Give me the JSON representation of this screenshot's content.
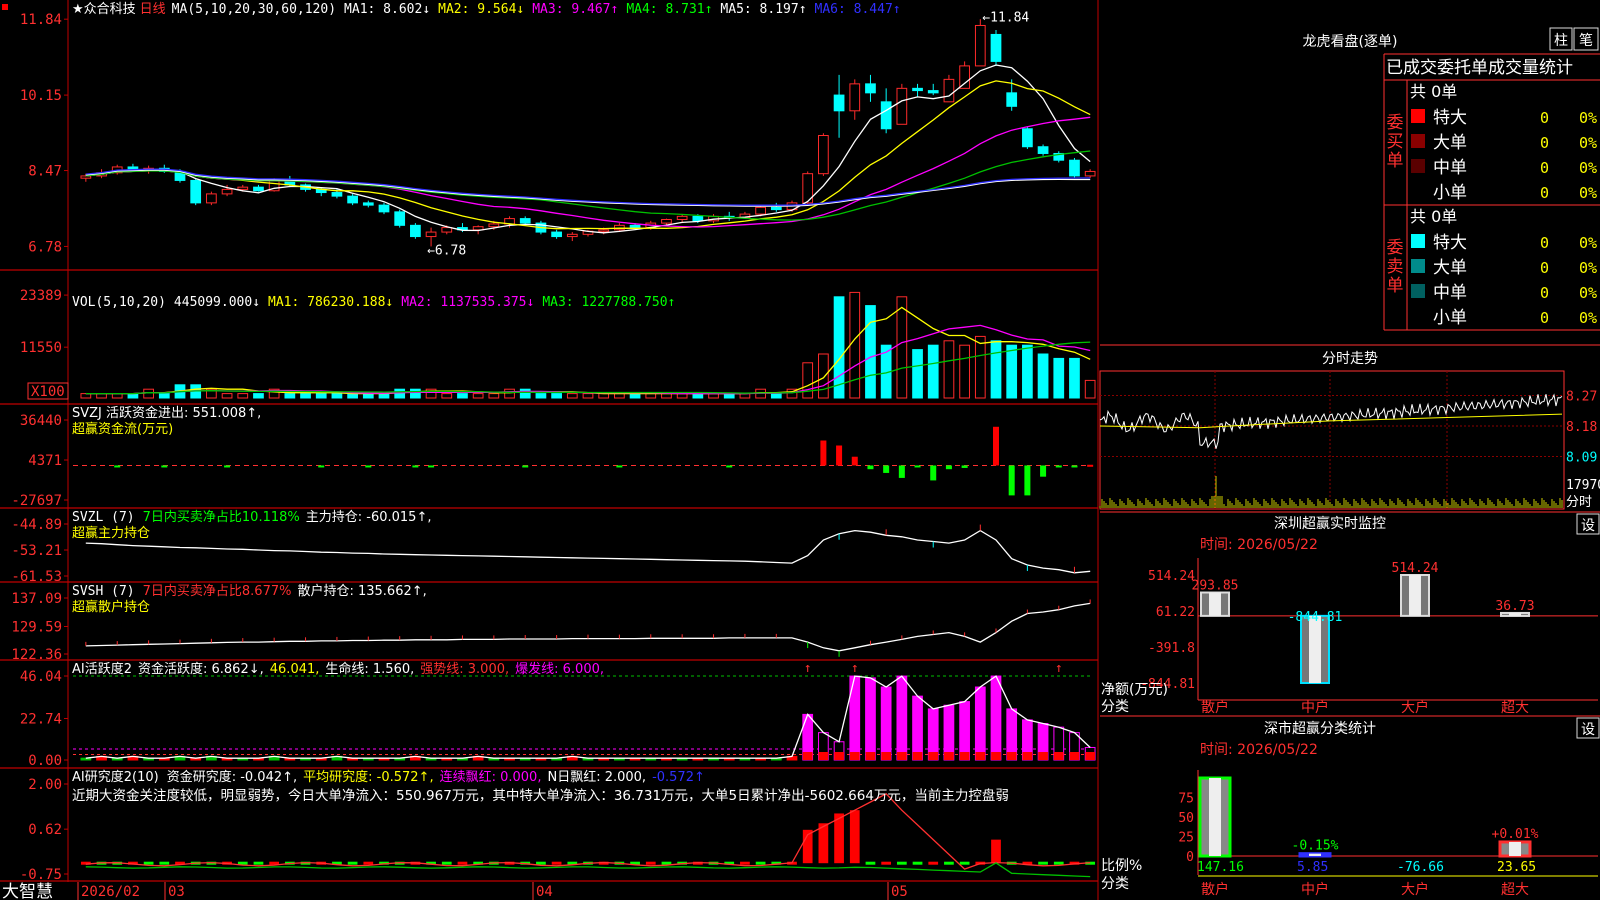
{
  "colors": {
    "up": "#ff2b2b",
    "down": "#00ffff",
    "grid": "#c00000",
    "yellow": "#ffff00",
    "magenta": "#ff00ff",
    "green": "#00c000",
    "white": "#ffffff"
  },
  "stock": {
    "name": "★众合科技",
    "period": "日线"
  },
  "price_panel": {
    "ma_head": "MA(5,10,20,30,60,120)",
    "ma_items": [
      {
        "label": "MA1:",
        "value": "8.602↓",
        "color": "#ffffff"
      },
      {
        "label": "MA2:",
        "value": "9.564↓",
        "color": "#ffff00"
      },
      {
        "label": "MA3:",
        "value": "9.467↑",
        "color": "#ff00ff"
      },
      {
        "label": "MA4:",
        "value": "8.731↑",
        "color": "#00ff00"
      },
      {
        "label": "MA5:",
        "value": "8.197↑",
        "color": "#ffffff"
      },
      {
        "label": "MA6:",
        "value": "8.447↑",
        "color": "#3030ff"
      }
    ],
    "y_ticks": [
      "11.84",
      "10.15",
      "8.47",
      "6.78"
    ],
    "high_label": "←11.84",
    "low_label": "←6.78"
  },
  "vol_panel": {
    "head": "VOL(5,10,20)",
    "value": "445099.000↓",
    "items": [
      {
        "label": "MA1:",
        "value": "786230.188↓",
        "color": "#ffff00"
      },
      {
        "label": "MA2:",
        "value": "1137535.375↓",
        "color": "#ff00ff"
      },
      {
        "label": "MA3:",
        "value": "1227788.750↑",
        "color": "#00ff00"
      }
    ],
    "y_ticks": [
      "23389",
      "11550",
      "X100"
    ]
  },
  "svzj_panel": {
    "line1": "SVZJ  活跃资金进出: 551.008↑,",
    "line2": "超赢资金流(万元)",
    "y_ticks": [
      "36440",
      "4371",
      "-27697"
    ]
  },
  "svzl_panel": {
    "name": "SVZL (7)",
    "desc": "7日内买卖净占比10.118%",
    "extra": "主力持仓: -60.015↑,",
    "line2": "超赢主力持仓",
    "y_ticks": [
      "-44.89",
      "-53.21",
      "-61.53"
    ]
  },
  "svsh_panel": {
    "name": "SVSH (7)",
    "desc": "7日内买卖净占比8.677%",
    "extra": "散户持仓: 135.662↑,",
    "line2": "超赢散户持仓",
    "y_ticks": [
      "137.09",
      "129.59",
      "122.36"
    ]
  },
  "ai1_panel": {
    "head": "AI活跃度2",
    "items": [
      {
        "text": "资金活跃度: 6.862↓,",
        "color": "#ffffff"
      },
      {
        "text": "46.041,",
        "color": "#ffff00"
      },
      {
        "text": "生命线: 1.560,",
        "color": "#ffffff"
      },
      {
        "text": "强势线: 3.000,",
        "color": "#ff3030"
      },
      {
        "text": "爆发线: 6.000,",
        "color": "#ff00ff"
      }
    ],
    "y_ticks": [
      "46.04",
      "22.74",
      "0.00"
    ]
  },
  "ai2_panel": {
    "head": "AI研究度2(10)",
    "items": [
      {
        "text": "资金研究度: -0.042↑,",
        "color": "#ffffff"
      },
      {
        "text": "平均研究度: -0.572↑,",
        "color": "#ffff00"
      },
      {
        "text": "连续飘红: 0.000,",
        "color": "#ff00ff"
      },
      {
        "text": "N日飘红: 2.000,",
        "color": "#ffffff"
      },
      {
        "text": "-0.572↑",
        "color": "#3030ff"
      }
    ],
    "comment": "近期大资金关注度较低，明显弱势，今日大单净流入：550.967万元，其中特大单净流入：36.731万元，大单5日累计净出-5602.664万元，当前主力控盘弱",
    "y_ticks": [
      "2.00",
      "0.62",
      "-0.75"
    ]
  },
  "x_axis": {
    "brand": "大智慧",
    "labels": [
      "2026/02",
      "03",
      "04",
      "05"
    ]
  },
  "right": {
    "lhb": {
      "title": "龙虎看盘(逐单)",
      "btn1": "柱",
      "btn2": "笔",
      "tabs": "已成交委托单成交量统计",
      "buy": {
        "side": "委买单",
        "total": "共 0单",
        "rows": [
          {
            "name": "特大",
            "count": "0",
            "pct": "0%",
            "color": "#ff0000"
          },
          {
            "name": "大单",
            "count": "0",
            "pct": "0%",
            "color": "#8b0000"
          },
          {
            "name": "中单",
            "count": "0",
            "pct": "0%",
            "color": "#5a0000"
          },
          {
            "name": "小单",
            "count": "0",
            "pct": "0%",
            "color": "#000000"
          }
        ]
      },
      "sell": {
        "side": "委卖单",
        "total": "共 0单",
        "rows": [
          {
            "name": "特大",
            "count": "0",
            "pct": "0%",
            "color": "#00ffff"
          },
          {
            "name": "大单",
            "count": "0",
            "pct": "0%",
            "color": "#008b8b"
          },
          {
            "name": "中单",
            "count": "0",
            "pct": "0%",
            "color": "#006060"
          },
          {
            "name": "小单",
            "count": "0",
            "pct": "0%",
            "color": "#000000"
          }
        ]
      }
    },
    "intraday": {
      "title": "分时走势",
      "y_ticks": [
        "8.27",
        "8.18",
        "8.09"
      ],
      "vol_tick": "17970",
      "footer": "分时"
    },
    "monitor": {
      "title": "深圳超赢实时监控",
      "btn": "设",
      "time": "时间: 2026/05/22",
      "y_ticks": [
        "514.24",
        "61.22",
        "-391.8",
        "-844.81"
      ],
      "bars": [
        {
          "cat": "散户",
          "value": 293.85,
          "label": "293.85"
        },
        {
          "cat": "中户",
          "value": -844.81,
          "label": "-844.81"
        },
        {
          "cat": "大户",
          "value": 514.24,
          "label": "514.24"
        },
        {
          "cat": "超大",
          "value": 36.73,
          "label": "36.73"
        }
      ],
      "ylabel": "净额(万元)",
      "xlabel": "分类"
    },
    "classify": {
      "title": "深市超赢分类统计",
      "btn": "设",
      "time": "时间: 2026/05/22",
      "y_ticks": [
        "75",
        "50",
        "25",
        "0"
      ],
      "pct_labels": [
        "",
        "-0.15%",
        "",
        "+0.01%"
      ],
      "values": [
        "147.16",
        "5.85",
        "-76.66",
        "23.65"
      ],
      "cats": [
        "散户",
        "中户",
        "大户",
        "超大"
      ],
      "ylabel": "比例%",
      "xlabel": "分类"
    }
  },
  "chart_data": [
    {
      "type": "candlestick",
      "title": "众合科技 日线",
      "ylim": [
        6.3,
        12.0
      ],
      "ohlc": [
        [
          8.3,
          8.4,
          8.22,
          8.35
        ],
        [
          8.35,
          8.5,
          8.3,
          8.42
        ],
        [
          8.42,
          8.6,
          8.38,
          8.55
        ],
        [
          8.55,
          8.62,
          8.45,
          8.48
        ],
        [
          8.48,
          8.58,
          8.4,
          8.52
        ],
        [
          8.52,
          8.6,
          8.42,
          8.45
        ],
        [
          8.45,
          8.5,
          8.2,
          8.25
        ],
        [
          8.25,
          8.3,
          7.7,
          7.75
        ],
        [
          7.75,
          8.0,
          7.7,
          7.95
        ],
        [
          7.95,
          8.15,
          7.9,
          8.05
        ],
        [
          8.05,
          8.15,
          8.0,
          8.1
        ],
        [
          8.1,
          8.15,
          8.0,
          8.02
        ],
        [
          8.02,
          8.3,
          8.0,
          8.25
        ],
        [
          8.25,
          8.35,
          8.1,
          8.15
        ],
        [
          8.15,
          8.18,
          8.0,
          8.05
        ],
        [
          8.05,
          8.1,
          7.9,
          7.98
        ],
        [
          7.98,
          8.05,
          7.85,
          7.9
        ],
        [
          7.9,
          7.95,
          7.7,
          7.75
        ],
        [
          7.75,
          7.8,
          7.65,
          7.7
        ],
        [
          7.7,
          7.75,
          7.5,
          7.55
        ],
        [
          7.55,
          7.6,
          7.2,
          7.25
        ],
        [
          7.25,
          7.3,
          6.95,
          7.0
        ],
        [
          7.0,
          7.2,
          6.78,
          7.1
        ],
        [
          7.1,
          7.25,
          7.05,
          7.2
        ],
        [
          7.2,
          7.3,
          7.1,
          7.15
        ],
        [
          7.15,
          7.25,
          7.05,
          7.22
        ],
        [
          7.22,
          7.35,
          7.15,
          7.28
        ],
        [
          7.28,
          7.45,
          7.2,
          7.4
        ],
        [
          7.4,
          7.45,
          7.25,
          7.3
        ],
        [
          7.3,
          7.35,
          7.05,
          7.1
        ],
        [
          7.1,
          7.15,
          6.95,
          7.0
        ],
        [
          7.0,
          7.1,
          6.9,
          7.05
        ],
        [
          7.05,
          7.15,
          7.0,
          7.12
        ],
        [
          7.12,
          7.2,
          7.05,
          7.15
        ],
        [
          7.15,
          7.3,
          7.1,
          7.25
        ],
        [
          7.25,
          7.3,
          7.15,
          7.2
        ],
        [
          7.2,
          7.35,
          7.15,
          7.3
        ],
        [
          7.3,
          7.4,
          7.25,
          7.38
        ],
        [
          7.38,
          7.5,
          7.3,
          7.45
        ],
        [
          7.45,
          7.5,
          7.3,
          7.35
        ],
        [
          7.35,
          7.5,
          7.3,
          7.45
        ],
        [
          7.45,
          7.55,
          7.35,
          7.42
        ],
        [
          7.42,
          7.55,
          7.4,
          7.5
        ],
        [
          7.5,
          7.7,
          7.45,
          7.65
        ],
        [
          7.65,
          7.75,
          7.55,
          7.6
        ],
        [
          7.6,
          7.8,
          7.55,
          7.75
        ],
        [
          7.75,
          8.45,
          7.7,
          8.4
        ],
        [
          8.4,
          9.3,
          8.35,
          9.25
        ],
        [
          10.15,
          10.6,
          9.2,
          9.8
        ],
        [
          9.8,
          10.5,
          9.6,
          10.4
        ],
        [
          10.4,
          10.6,
          10.0,
          10.2
        ],
        [
          10.0,
          10.3,
          9.3,
          9.4
        ],
        [
          9.5,
          10.4,
          9.5,
          10.3
        ],
        [
          10.3,
          10.4,
          10.1,
          10.25
        ],
        [
          10.25,
          10.4,
          10.15,
          10.2
        ],
        [
          10.0,
          10.6,
          10.0,
          10.5
        ],
        [
          10.3,
          10.9,
          10.3,
          10.8
        ],
        [
          10.8,
          11.84,
          10.8,
          11.7
        ],
        [
          11.5,
          11.6,
          10.8,
          10.9
        ],
        [
          10.2,
          10.5,
          9.8,
          9.9
        ],
        [
          9.4,
          9.45,
          8.95,
          9.0
        ],
        [
          9.0,
          9.05,
          8.8,
          8.85
        ],
        [
          8.85,
          8.9,
          8.65,
          8.7
        ],
        [
          8.7,
          8.75,
          8.3,
          8.35
        ],
        [
          8.35,
          8.5,
          8.3,
          8.45
        ]
      ]
    },
    {
      "type": "bar",
      "title": "VOL(5,10,20)",
      "values": [
        1,
        1,
        1,
        1,
        2,
        1,
        3,
        3,
        2,
        1,
        1,
        1,
        2,
        1,
        1,
        1,
        1,
        1,
        1,
        1,
        2,
        2,
        2,
        1,
        1,
        1,
        1,
        2,
        2,
        1,
        1,
        1,
        1,
        1,
        1,
        1,
        1,
        1,
        1,
        1,
        1,
        1,
        1,
        2,
        1,
        2,
        8,
        10,
        23,
        24,
        21,
        12,
        23,
        11,
        12,
        13,
        12,
        14,
        13,
        12,
        12,
        10,
        9,
        9,
        4
      ]
    },
    {
      "type": "bar",
      "title": "SVZJ 活跃资金进出",
      "values": [
        0,
        0,
        -500,
        0,
        0,
        -600,
        0,
        0,
        0,
        -400,
        0,
        0,
        0,
        0,
        0,
        -500,
        0,
        0,
        -300,
        0,
        0,
        -500,
        -400,
        0,
        0,
        0,
        0,
        0,
        -500,
        0,
        0,
        0,
        0,
        0,
        -400,
        0,
        0,
        0,
        0,
        0,
        0,
        -300,
        0,
        0,
        0,
        0,
        0,
        20000,
        16000,
        7000,
        -3000,
        -6000,
        -10000,
        -1000,
        -12000,
        -3000,
        -2000,
        0,
        31000,
        -24000,
        -24000,
        -9000,
        -1000,
        -1500,
        551
      ]
    },
    {
      "type": "line",
      "title": "SVZL 主力持仓",
      "values": [
        -51,
        -51.2,
        -51.5,
        -51.8,
        -52,
        -52.2,
        -52.4,
        -52.5,
        -52.7,
        -52.9,
        -53,
        -53.2,
        -53.4,
        -53.5,
        -53.7,
        -53.9,
        -54,
        -54.2,
        -54.3,
        -54.5,
        -54.6,
        -54.7,
        -54.8,
        -54.9,
        -55,
        -55.1,
        -55.2,
        -55.3,
        -55.4,
        -55.5,
        -55.6,
        -55.7,
        -55.8,
        -55.9,
        -56,
        -56.1,
        -56.2,
        -56.3,
        -56.4,
        -56.5,
        -56.6,
        -56.7,
        -56.8,
        -57,
        -57.2,
        -57.4,
        -55,
        -50,
        -48,
        -47,
        -47.5,
        -48.5,
        -49,
        -50,
        -50.5,
        -51,
        -50,
        -47,
        -50,
        -56,
        -58,
        -59,
        -59.5,
        -60.5,
        -60.015
      ]
    },
    {
      "type": "line",
      "title": "SVSH 散户持仓",
      "values": [
        124.5,
        124.6,
        124.7,
        124.8,
        124.9,
        125,
        125.1,
        125.2,
        125.3,
        125.4,
        125.5,
        125.5,
        125.6,
        125.7,
        125.7,
        125.8,
        125.8,
        125.9,
        125.9,
        126,
        126,
        126.1,
        126.1,
        126.1,
        126.2,
        126.2,
        126.2,
        126.3,
        126.3,
        126.3,
        126.3,
        126.4,
        126.4,
        126.4,
        126.4,
        126.4,
        126.5,
        126.5,
        126.5,
        126.5,
        126.5,
        126.6,
        126.6,
        126.6,
        126.6,
        126.6,
        125.5,
        124,
        123.2,
        124,
        124.8,
        125.5,
        126.2,
        127,
        127.5,
        128,
        127,
        125.5,
        128,
        131,
        133,
        133.4,
        134,
        135,
        135.662
      ]
    },
    {
      "type": "bar",
      "title": "AI活跃度2",
      "values": [
        1,
        2,
        1,
        2,
        1,
        1,
        2,
        1,
        2,
        1,
        1,
        1,
        2,
        1,
        1,
        1,
        2,
        1,
        1,
        1,
        1,
        2,
        1,
        1,
        1,
        2,
        1,
        1,
        1,
        1,
        1,
        2,
        1,
        1,
        1,
        1,
        1,
        1,
        1,
        1,
        1,
        1,
        1,
        1,
        1,
        2,
        25,
        15,
        10,
        46,
        45,
        40,
        46,
        35,
        28,
        30,
        32,
        40,
        46,
        28,
        22,
        20,
        18,
        15,
        6.862
      ],
      "hlines": [
        46.041,
        6,
        3,
        1.56
      ]
    },
    {
      "type": "bar",
      "title": "AI研究度2(10)",
      "values": [
        -0.4,
        -0.3,
        -0.4,
        -0.45,
        -0.5,
        -0.3,
        -0.4,
        -0.5,
        -0.45,
        -0.35,
        -0.4,
        -0.45,
        -0.4,
        -0.3,
        -0.35,
        -0.4,
        -0.45,
        -0.4,
        -0.5,
        -0.45,
        -0.4,
        -0.35,
        -0.4,
        -0.3,
        -0.4,
        -0.45,
        -0.4,
        -0.45,
        -0.5,
        -0.35,
        -0.4,
        -0.45,
        -0.4,
        -0.35,
        -0.3,
        -0.4,
        -0.45,
        -0.5,
        -0.4,
        -0.35,
        -0.45,
        -0.4,
        -0.3,
        -0.35,
        -0.4,
        -0.3,
        0.6,
        0.8,
        1.1,
        1.2,
        -0.4,
        -0.45,
        -0.5,
        -0.4,
        -0.45,
        -0.5,
        -0.45,
        -0.5,
        0.3,
        -0.5,
        -0.45,
        -0.5,
        -0.5,
        -0.5,
        -0.042
      ]
    }
  ]
}
